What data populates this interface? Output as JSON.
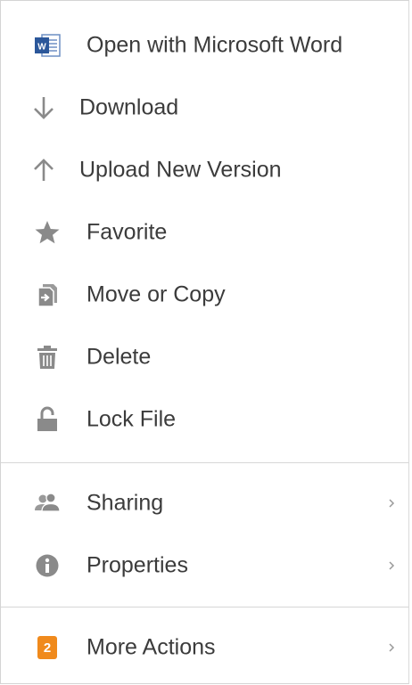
{
  "menu": {
    "items": [
      {
        "label": "Open with Microsoft Word",
        "icon": "word-icon"
      },
      {
        "label": "Download",
        "icon": "arrow-down-icon"
      },
      {
        "label": "Upload New Version",
        "icon": "arrow-up-icon"
      },
      {
        "label": "Favorite",
        "icon": "star-icon"
      },
      {
        "label": "Move or Copy",
        "icon": "move-copy-icon"
      },
      {
        "label": "Delete",
        "icon": "trash-icon"
      },
      {
        "label": "Lock File",
        "icon": "lock-icon"
      },
      {
        "label": "Sharing",
        "icon": "users-icon",
        "has_submenu": true
      },
      {
        "label": "Properties",
        "icon": "info-icon",
        "has_submenu": true
      },
      {
        "label": "More Actions",
        "icon": "badge-icon",
        "badge": "2",
        "has_submenu": true
      }
    ]
  },
  "colors": {
    "text": "#3b3b3b",
    "icon": "#8a8a8a",
    "badge": "#f08a1c",
    "divider": "#d6d6d6",
    "word_blue": "#2b579a"
  }
}
